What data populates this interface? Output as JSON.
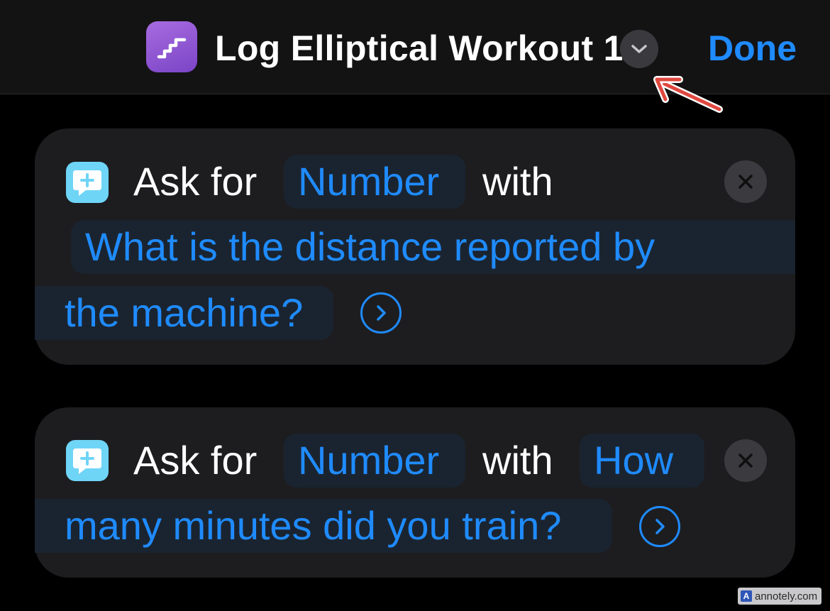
{
  "header": {
    "title": "Log Elliptical Workout 1",
    "done_label": "Done",
    "app_icon": "stairs-icon",
    "accent_color": "#1f8bff"
  },
  "actions": [
    {
      "prefix": "Ask for",
      "type_value": "Number",
      "connector": "with",
      "prompt_line1": "What is the distance reported by",
      "prompt_line2": "the machine?",
      "icon": "ask-speech-bubble-icon"
    },
    {
      "prefix": "Ask for",
      "type_value": "Number",
      "connector": "with",
      "prompt_line1": "How",
      "prompt_line2": "many minutes did you train?",
      "icon": "ask-speech-bubble-icon"
    }
  ],
  "watermark": {
    "logo_letter": "A",
    "text": "annotely.com"
  }
}
